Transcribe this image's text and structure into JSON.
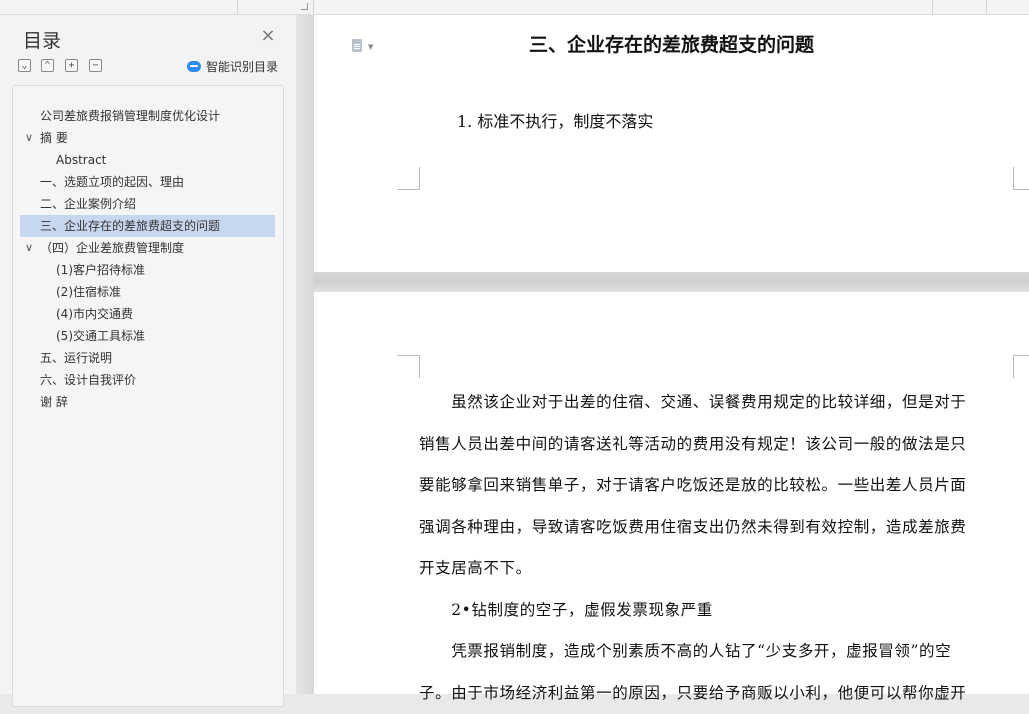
{
  "toolbar": {},
  "sidebar": {
    "title": "目录",
    "close_glyph": "×",
    "controls": [
      {
        "name": "collapse-all-button",
        "glyph": "⌄"
      },
      {
        "name": "expand-all-button",
        "glyph": "⌃"
      },
      {
        "name": "add-level-button",
        "glyph": "+"
      },
      {
        "name": "remove-level-button",
        "glyph": "−"
      }
    ],
    "smart_toc_label": "智能识别目录",
    "items": [
      {
        "label": "公司差旅费报销管理制度优化设计",
        "level": 0,
        "arrow": ""
      },
      {
        "label": "摘  要",
        "level": 0,
        "arrow": "∨"
      },
      {
        "label": "Abstract",
        "level": 1,
        "arrow": ""
      },
      {
        "label": "一、选题立项的起因、理由",
        "level": 0,
        "arrow": ""
      },
      {
        "label": "二、企业案例介绍",
        "level": 0,
        "arrow": ""
      },
      {
        "label": "三、企业存在的差旅费超支的问题",
        "level": 0,
        "arrow": "",
        "selected": true
      },
      {
        "label": "（四）企业差旅费管理制度",
        "level": 0,
        "arrow": "∨"
      },
      {
        "label": "(1)客户招待标准",
        "level": 1,
        "arrow": ""
      },
      {
        "label": "(2)住宿标准",
        "level": 1,
        "arrow": ""
      },
      {
        "label": "(4)市内交通费",
        "level": 1,
        "arrow": ""
      },
      {
        "label": "(5)交通工具标准",
        "level": 1,
        "arrow": ""
      },
      {
        "label": "五、运行说明",
        "level": 0,
        "arrow": ""
      },
      {
        "label": "六、设计自我评价",
        "level": 0,
        "arrow": ""
      },
      {
        "label": "谢 辞",
        "level": 0,
        "arrow": ""
      }
    ]
  },
  "document": {
    "page1": {
      "heading": "三、企业存在的差旅费超支的问题",
      "subheading": "1.  标准不执行，制度不落实"
    },
    "page2": {
      "paragraph1": [
        "　　虽然该企业对于出差的住宿、交通、误餐费用规定的比较详细，但是对于",
        "销售人员出差中间的请客送礼等活动的费用没有规定！该公司一般的做法是只",
        "要能够拿回来销售单子，对于请客户吃饭还是放的比较松。一些出差人员片面",
        "强调各种理由，导致请客吃饭费用住宿支出仍然未得到有效控制，造成差旅费",
        "开支居高不下。"
      ],
      "subheading2": "　　2•钻制度的空子，虚假发票现象严重",
      "paragraph2": [
        "　　凭票报销制度，造成个别素质不高的人钻了“少支多开，虚报冒领”的空",
        "子。由于市场经济利益第一的原因，只要给予商贩以小利，他便可以帮你虚开"
      ]
    }
  }
}
